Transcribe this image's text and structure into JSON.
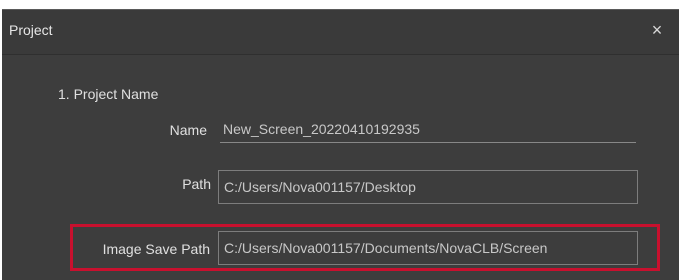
{
  "dialog": {
    "title": "Project",
    "close_symbol": "×"
  },
  "section": {
    "title": "1. Project Name"
  },
  "fields": {
    "name": {
      "label": "Name",
      "value": "New_Screen_20220410192935"
    },
    "path": {
      "label": "Path",
      "value": "C:/Users/Nova001157/Desktop"
    },
    "image_save_path": {
      "label": "Image Save Path",
      "value": "C:/Users/Nova001157/Documents/NovaCLB/Screen"
    }
  },
  "colors": {
    "dialog_background": "#3d3d3d",
    "highlight_border": "#c8102e",
    "text": "#e0e0e0"
  }
}
